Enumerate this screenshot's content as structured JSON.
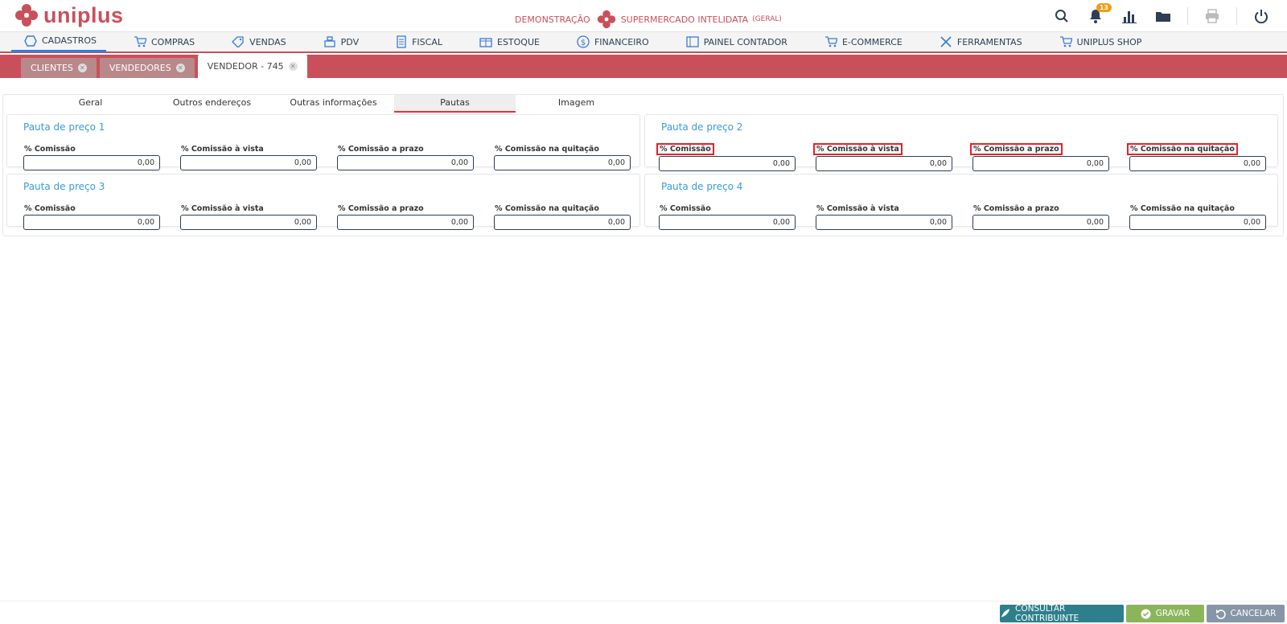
{
  "app": {
    "brand": "uniplus"
  },
  "header": {
    "mode": "DEMONSTRAÇÃO",
    "company": "SUPERMERCADO INTELIDATA",
    "company_scope": "(GERAL)",
    "notifications_count": "13"
  },
  "menu": {
    "items": [
      {
        "label": "CADASTROS",
        "icon": "hexagon-icon"
      },
      {
        "label": "COMPRAS",
        "icon": "cart-icon"
      },
      {
        "label": "VENDAS",
        "icon": "tag-icon"
      },
      {
        "label": "PDV",
        "icon": "register-icon"
      },
      {
        "label": "FISCAL",
        "icon": "document-icon"
      },
      {
        "label": "ESTOQUE",
        "icon": "box-icon"
      },
      {
        "label": "FINANCEIRO",
        "icon": "dollar-icon"
      },
      {
        "label": "PAINEL CONTADOR",
        "icon": "ledger-icon"
      },
      {
        "label": "E-COMMERCE",
        "icon": "cart-icon"
      },
      {
        "label": "FERRAMENTAS",
        "icon": "tools-icon"
      },
      {
        "label": "UNIPLUS SHOP",
        "icon": "cart-icon"
      }
    ]
  },
  "doc_tabs": [
    {
      "label": "CLIENTES"
    },
    {
      "label": "VENDEDORES"
    },
    {
      "label": "VENDEDOR - 745"
    }
  ],
  "subtabs": [
    {
      "label": "Geral"
    },
    {
      "label": "Outros endereços"
    },
    {
      "label": "Outras informações"
    },
    {
      "label": "Pautas"
    },
    {
      "label": "Imagem"
    }
  ],
  "panels": [
    {
      "title": "Pauta de preço 1",
      "fields": [
        {
          "label": "% Comissão",
          "value": "0,00"
        },
        {
          "label": "% Comissão à vista",
          "value": "0,00"
        },
        {
          "label": "% Comissão a prazo",
          "value": "0,00"
        },
        {
          "label": "% Comissão na quitação",
          "value": "0,00"
        }
      ]
    },
    {
      "title": "Pauta de preço 2",
      "fields": [
        {
          "label": "% Comissão",
          "value": "0,00"
        },
        {
          "label": "% Comissão à vista",
          "value": "0,00"
        },
        {
          "label": "% Comissão a prazo",
          "value": "0,00"
        },
        {
          "label": "% Comissão na quitação",
          "value": "0,00"
        }
      ]
    },
    {
      "title": "Pauta de preço 3",
      "fields": [
        {
          "label": "% Comissão",
          "value": "0,00"
        },
        {
          "label": "% Comissão à vista",
          "value": "0,00"
        },
        {
          "label": "% Comissão a prazo",
          "value": "0,00"
        },
        {
          "label": "% Comissão na quitação",
          "value": "0,00"
        }
      ]
    },
    {
      "title": "Pauta de preço 4",
      "fields": [
        {
          "label": "% Comissão",
          "value": "0,00"
        },
        {
          "label": "% Comissão à vista",
          "value": "0,00"
        },
        {
          "label": "% Comissão a prazo",
          "value": "0,00"
        },
        {
          "label": "% Comissão na quitação",
          "value": "0,00"
        }
      ]
    }
  ],
  "footer": {
    "consultar_label": "CONSULTAR CONTRIBUINTE",
    "gravar_label": "GRAVAR",
    "cancelar_label": "CANCELAR"
  },
  "colors": {
    "brand_red": "#c9505a",
    "link_blue": "#3a9bd9",
    "consultar_bg": "#2e7f8c",
    "gravar_bg": "#8bb55a",
    "cancelar_bg": "#8796a6"
  }
}
